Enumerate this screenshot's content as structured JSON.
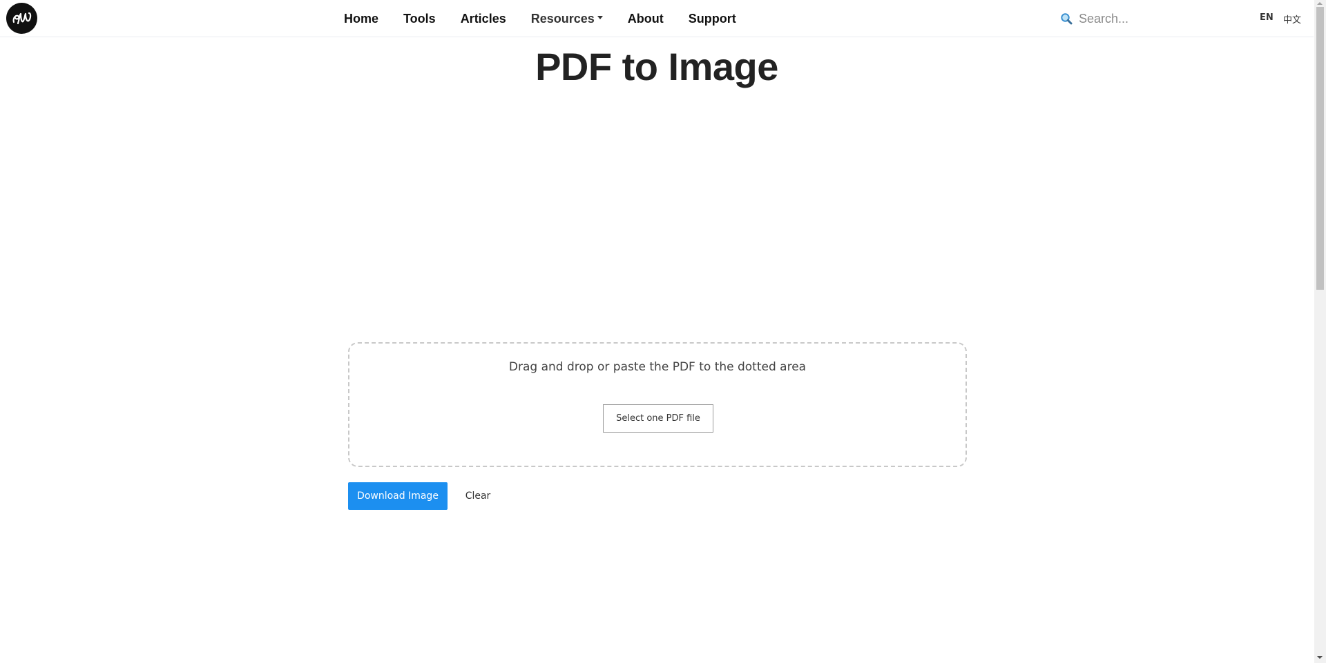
{
  "header": {
    "logo_icon": "ew-script-logo",
    "nav": [
      {
        "label": "Home"
      },
      {
        "label": "Tools"
      },
      {
        "label": "Articles"
      },
      {
        "label": "Resources",
        "has_dropdown": true
      },
      {
        "label": "About"
      },
      {
        "label": "Support"
      }
    ],
    "search": {
      "icon": "magnifier-icon",
      "placeholder": "Search..."
    },
    "languages": [
      "EN",
      "中文"
    ]
  },
  "main": {
    "title": "PDF to Image",
    "dropzone": {
      "instruction": "Drag and drop or paste the PDF to the dotted area",
      "select_button": "Select one PDF file"
    },
    "actions": {
      "download_label": "Download Image",
      "clear_label": "Clear"
    }
  },
  "colors": {
    "primary_button": "#1c8ff0",
    "logo_background": "#111111",
    "dropzone_border": "#c8c8c8"
  }
}
